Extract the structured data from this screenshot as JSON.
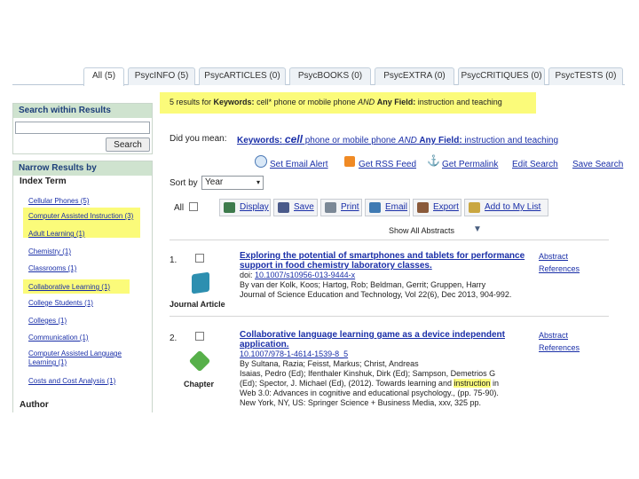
{
  "tabs": [
    {
      "label": "All (5)",
      "active": true
    },
    {
      "label": "PsycINFO (5)",
      "active": false
    },
    {
      "label": "PsycARTICLES (0)",
      "active": false
    },
    {
      "label": "PsycBOOKS (0)",
      "active": false
    },
    {
      "label": "PsycEXTRA (0)",
      "active": false
    },
    {
      "label": "PsycCRITIQUES (0)",
      "active": false
    },
    {
      "label": "PsycTESTS (0)",
      "active": false
    }
  ],
  "sidebar": {
    "search_within": {
      "heading": "Search within Results",
      "input_value": "",
      "button_label": "Search"
    },
    "narrow": {
      "heading": "Narrow Results by",
      "index_term_label": "Index Term",
      "facets": [
        {
          "label": "Cellular Phones (5)",
          "highlighted": false
        },
        {
          "label": "Computer Assisted Instruction (3)",
          "highlighted": true
        },
        {
          "label": "Adult Learning (1)",
          "highlighted": true
        },
        {
          "label": "Chemistry (1)",
          "highlighted": false
        },
        {
          "label": "Classrooms (1)",
          "highlighted": false
        },
        {
          "label": "Collaborative Learning (1)",
          "highlighted": true
        },
        {
          "label": "College Students (1)",
          "highlighted": false
        },
        {
          "label": "Colleges (1)",
          "highlighted": false
        },
        {
          "label": "Communication (1)",
          "highlighted": false
        },
        {
          "label": "Computer Assisted Language Learning (1)",
          "highlighted": false
        },
        {
          "label": "Costs and Cost Analysis (1)",
          "highlighted": false
        }
      ],
      "author_label": "Author"
    }
  },
  "main": {
    "results_summary": {
      "count_text": "5 results for",
      "label": "Keywords:",
      "query_part1": "cell* phone or mobile phone",
      "and_word": "AND",
      "field_label": "Any Field:",
      "query_part2": "instruction and teaching"
    },
    "did_you_mean": {
      "label": "Did you mean:",
      "prefix": "Keywords:",
      "keyword": "cell",
      "rest": " phone or mobile phone ",
      "and_word": "AND",
      "field": " Any Field:",
      "tail": " instruction and teaching"
    },
    "actions": {
      "email_alert": "Set Email Alert",
      "rss_feed": "Get RSS Feed",
      "permalink": "Get Permalink",
      "edit_search": "Edit Search",
      "save_search": "Save Search"
    },
    "sort": {
      "label": "Sort by",
      "selected": "Year"
    },
    "toolbar": {
      "all_label": "All",
      "display": "Display",
      "save": "Save",
      "print": "Print",
      "email": "Email",
      "export": "Export",
      "add_to_list": "Add to My List"
    },
    "show_abstracts": "Show All Abstracts",
    "results": [
      {
        "number": "1.",
        "type": "Journal Article",
        "title_line1": "Exploring the potential of smartphones and tablets for performance",
        "title_line2": "support in food chemistry laboratory classes.",
        "doi_label": "doi:",
        "doi": "10.1007/s10956-013-9444-x",
        "authors": "By van der Kolk, Koos; Hartog, Rob; Beldman, Gerrit; Gruppen, Harry",
        "source": "Journal of Science Education and Technology, Vol 22(6), Dec 2013, 904-992.",
        "link_abstract": "Abstract",
        "link_references": "References"
      },
      {
        "number": "2.",
        "type": "Chapter",
        "title_line1": "Collaborative language learning game as a device independent",
        "title_line2": "application.",
        "doi_label": "",
        "doi": "10.1007/978-1-4614-1539-8_5",
        "line_a": "By Sultana, Razia; Feisst, Markus; Christ, Andreas",
        "line_b": "Isaias, Pedro (Ed); Ifenthaler Kinshuk, Dirk (Ed); Sampson, Demetrios G",
        "line_c_pre": "(Ed); Spector, J. Michael (Ed), (2012). Towards learning and",
        "line_c_hl": "instruction",
        "line_c_post": "in",
        "line_d": "Web 3.0: Advances in cognitive and educational psychology., (pp. 75-90).",
        "line_e": "New York, NY, US: Springer Science + Business Media, xxv, 325 pp.",
        "link_abstract": "Abstract",
        "link_references": "References"
      }
    ]
  },
  "colors": {
    "highlight": "#fbfb7a",
    "link": "#1a2fa8",
    "sidebar_header": "#cfe3cf"
  }
}
